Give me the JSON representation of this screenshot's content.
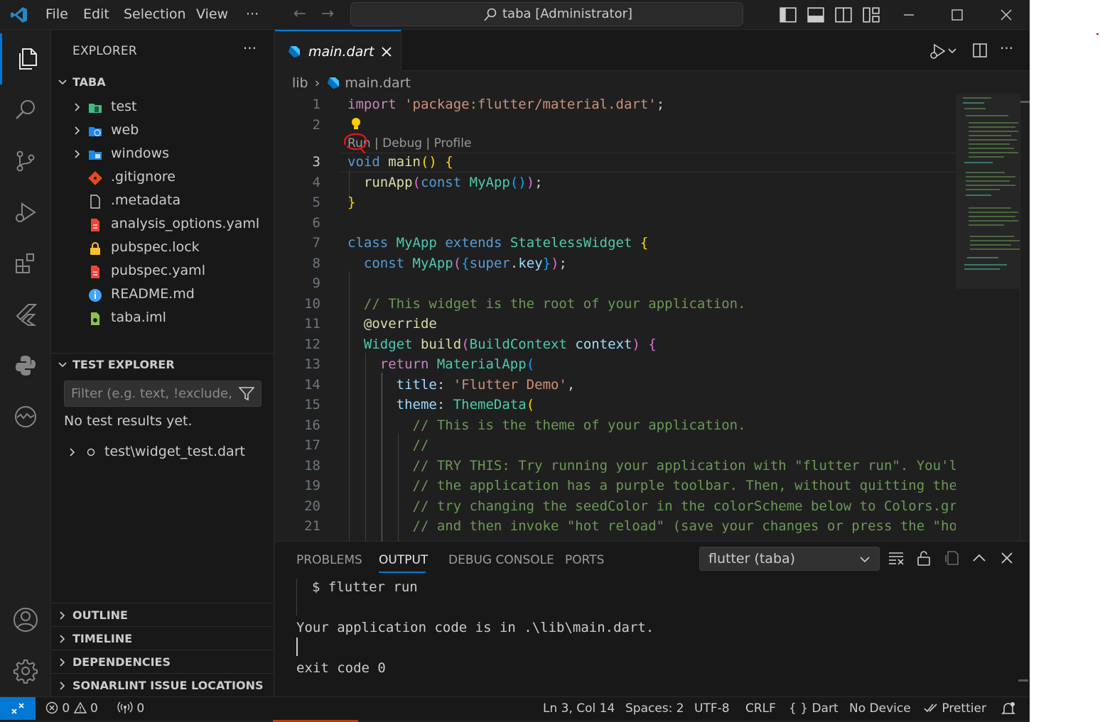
{
  "titlebar": {
    "menus": [
      "File",
      "Edit",
      "Selection",
      "View",
      "···"
    ],
    "search_text": "taba [Administrator]"
  },
  "sidebar": {
    "header": "EXPLORER",
    "more": "···",
    "project": "TABA",
    "files": [
      {
        "name": "test",
        "type": "folder-test"
      },
      {
        "name": "web",
        "type": "folder-web"
      },
      {
        "name": "windows",
        "type": "folder-windows"
      },
      {
        "name": ".gitignore",
        "type": "git"
      },
      {
        "name": ".metadata",
        "type": "file"
      },
      {
        "name": "analysis_options.yaml",
        "type": "yaml"
      },
      {
        "name": "pubspec.lock",
        "type": "lock"
      },
      {
        "name": "pubspec.yaml",
        "type": "yaml"
      },
      {
        "name": "README.md",
        "type": "info"
      },
      {
        "name": "taba.iml",
        "type": "iml"
      }
    ],
    "test_explorer": {
      "title": "TEST EXPLORER",
      "filter_placeholder": "Filter (e.g. text, !exclude, ...",
      "no_results": "No test results yet.",
      "item": "test\\widget_test.dart"
    },
    "bottom_sections": [
      "OUTLINE",
      "TIMELINE",
      "DEPENDENCIES",
      "SONARLINT ISSUE LOCATIONS"
    ]
  },
  "editor": {
    "tab": "main.dart",
    "breadcrumb": {
      "folder": "lib",
      "file": "main.dart"
    },
    "codelens": "Run | Debug | Profile",
    "line_numbers": [
      "1",
      "2",
      "3",
      "4",
      "5",
      "6",
      "7",
      "8",
      "9",
      "10",
      "11",
      "12",
      "13",
      "14",
      "15",
      "16",
      "17",
      "18",
      "19",
      "20",
      "21"
    ],
    "current_line": 3
  },
  "panel": {
    "tabs": [
      "PROBLEMS",
      "OUTPUT",
      "DEBUG CONSOLE",
      "PORTS"
    ],
    "active_tab": "OUTPUT",
    "channel": "flutter (taba)",
    "output": [
      "$ flutter run",
      "Your application code is in .\\lib\\main.dart.",
      "exit code 0"
    ]
  },
  "statusbar": {
    "errors": "0",
    "warnings": "0",
    "ports": "0",
    "position": "Ln 3, Col 14",
    "spaces": "Spaces: 2",
    "encoding": "UTF-8",
    "eol": "CRLF",
    "language": "Dart",
    "device": "No Device",
    "prettier": "Prettier"
  }
}
